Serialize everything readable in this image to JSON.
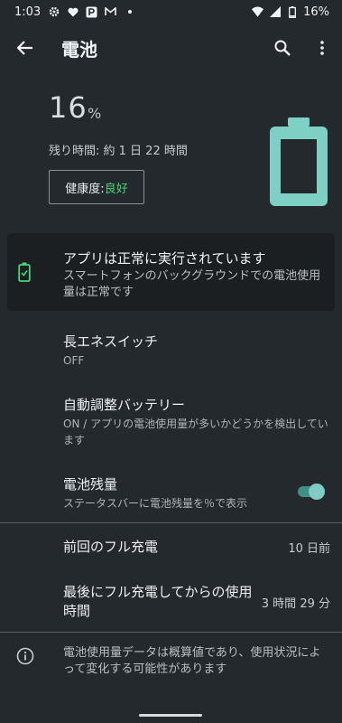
{
  "statusbar": {
    "time": "1:03",
    "battery": "16%"
  },
  "appbar": {
    "title": "電池"
  },
  "hero": {
    "percent": "16",
    "percent_sign": "%",
    "remaining": "残り時間: 約 1 日 22 時間",
    "health_label": "健康度: ",
    "health_value": "良好",
    "level_fraction": 0.16
  },
  "card": {
    "title": "アプリは正常に実行されています",
    "subtitle": "スマートフォンのバックグラウンドでの電池使用量は正常です"
  },
  "settings": [
    {
      "title": "長エネスイッチ",
      "summary": "OFF"
    },
    {
      "title": "自動調整バッテリー",
      "summary": "ON / アプリの電池使用量が多いかどうかを検出しています"
    },
    {
      "title": "電池残量",
      "summary": "ステータスバーに電池残量を％で表示",
      "toggle_on": true
    }
  ],
  "stats": [
    {
      "label": "前回のフル充電",
      "value": "10 日前"
    },
    {
      "label": "最後にフル充電してからの使用時間",
      "value": "3 時間 29 分"
    }
  ],
  "footer": {
    "text": "電池使用量データは概算値であり、使用状況によって変化する可能性があります"
  },
  "colors": {
    "accent": "#80cbc4",
    "good": "#4cd37a",
    "background": "#24292d",
    "battery": "#7ed0c4"
  }
}
